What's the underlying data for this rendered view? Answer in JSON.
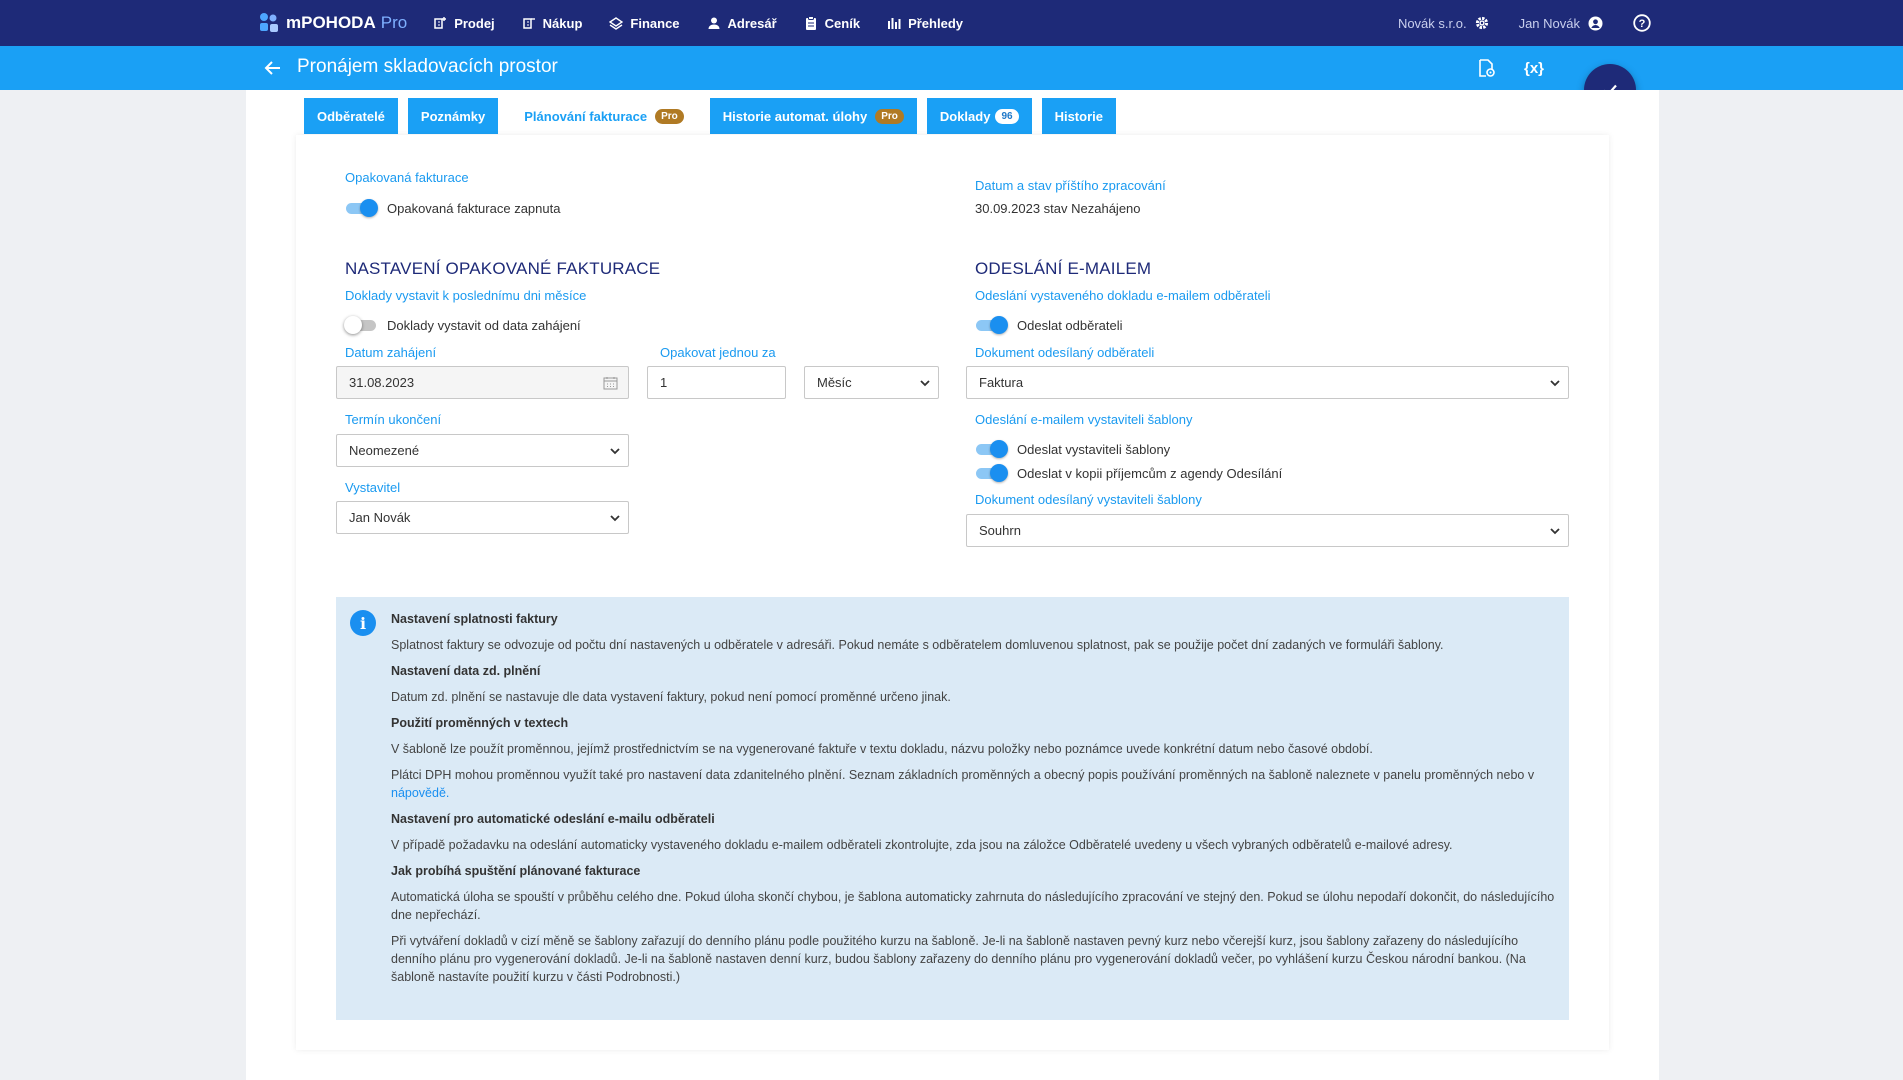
{
  "app": {
    "name": "mPOHODA",
    "edition": "Pro"
  },
  "nav": {
    "items": [
      {
        "label": "Prodej",
        "icon": "sales-icon"
      },
      {
        "label": "Nákup",
        "icon": "purchase-icon"
      },
      {
        "label": "Finance",
        "icon": "finance-icon"
      },
      {
        "label": "Adresář",
        "icon": "person-icon"
      },
      {
        "label": "Ceník",
        "icon": "clipboard-icon"
      },
      {
        "label": "Přehledy",
        "icon": "bar-chart-icon"
      }
    ],
    "company": "Novák s.r.o.",
    "user": "Jan Novák"
  },
  "page": {
    "title": "Pronájem skladovacích prostor",
    "variables_button": "{x}"
  },
  "tabs": [
    {
      "label": "Odběratelé"
    },
    {
      "label": "Poznámky"
    },
    {
      "label": "Plánování fakturace",
      "badge": "Pro",
      "active": true
    },
    {
      "label": "Historie automat. úlohy",
      "badge": "Pro"
    },
    {
      "label": "Doklady",
      "badge": "96"
    },
    {
      "label": "Historie"
    }
  ],
  "form": {
    "recurring_label": "Opakovaná fakturace",
    "recurring_toggle_label": "Opakovaná fakturace zapnuta",
    "next_processing_label": "Datum a stav příštího zpracování",
    "next_processing_value": "30.09.2023 stav Nezahájeno",
    "settings_heading": "NASTAVENÍ OPAKOVANÉ FAKTURACE",
    "last_day_label": "Doklady vystavit k poslednímu dni měsíce",
    "from_start_toggle_label": "Doklady vystavit od data zahájení",
    "start_date_label": "Datum zahájení",
    "start_date_value": "31.08.2023",
    "repeat_label": "Opakovat jednou za",
    "repeat_value": "1",
    "repeat_unit": "Měsíc",
    "end_label": "Termín ukončení",
    "end_value": "Neomezené",
    "issuer_label": "Vystavitel",
    "issuer_value": "Jan Novák",
    "email_heading": "ODESLÁNÍ E-MAILEM",
    "email_customer_label": "Odeslání vystaveného dokladu e-mailem odběrateli",
    "send_customer_toggle_label": "Odeslat odběrateli",
    "doc_customer_label": "Dokument odesílaný odběrateli",
    "doc_customer_value": "Faktura",
    "email_issuer_label": "Odeslání e-mailem vystaviteli šablony",
    "send_issuer_toggle_label": "Odeslat vystaviteli šablony",
    "send_copy_toggle_label": "Odeslat v kopii příjemcům z agendy Odesílání",
    "doc_issuer_label": "Dokument odesílaný vystaviteli šablony",
    "doc_issuer_value": "Souhrn"
  },
  "info": {
    "h1": "Nastavení splatnosti faktury",
    "p1": "Splatnost faktury se odvozuje od počtu dní nastavených u odběratele v adresáři. Pokud nemáte s odběratelem domluvenou splatnost, pak se použije počet dní zadaných ve formuláři šablony.",
    "h2": "Nastavení data zd. plnění",
    "p2": "Datum zd. plnění se nastavuje dle data vystavení faktury, pokud není pomocí proměnné určeno jinak.",
    "h3": "Použití proměnných v textech",
    "p3": "V šabloně lze použít proměnnou, jejímž prostřednictvím se na vygenerované faktuře v textu dokladu, názvu položky nebo poznámce uvede konkrétní datum nebo časové období.",
    "p4": "Plátci DPH mohou proměnnou využít také pro nastavení data zdanitelného plnění. Seznam základních proměnných a obecný popis používání proměnných na šabloně naleznete v panelu proměnných nebo v",
    "p4_link": "nápovědě.",
    "h4": "Nastavení pro automatické odeslání e-mailu odběrateli",
    "p5": "V případě požadavku na odeslání automaticky vystaveného dokladu e-mailem odběrateli zkontrolujte, zda jsou na záložce Odběratelé uvedeny u všech vybraných odběratelů e-mailové adresy.",
    "h5": "Jak probíhá spuštění plánované fakturace",
    "p6": "Automatická úloha se spouští v průběhu celého dne. Pokud úloha skončí chybou, je šablona automaticky zahrnuta do následujícího zpracování ve stejný den. Pokud se úlohu nepodaří dokončit, do následujícího dne nepřechází.",
    "p7": "Při vytváření dokladů v cizí měně se šablony zařazují do denního plánu podle použitého kurzu na šabloně. Je-li na šabloně nastaven pevný kurz nebo včerejší kurz, jsou šablony zařazeny do následujícího denního plánu pro vygenerování dokladů. Je-li na šabloně nastaven denní kurz, budou šablony zařazeny do denního plánu pro vygenerování dokladů večer, po vyhlášení kurzu Českou národní bankou. (Na šabloně nastavíte použití kurzu v části Podrobnosti.)"
  },
  "colors": {
    "nav": "#1e2a78",
    "accent": "#1aa0f5",
    "info_bg": "#dbeaf6",
    "pro_badge": "#b07a24"
  }
}
